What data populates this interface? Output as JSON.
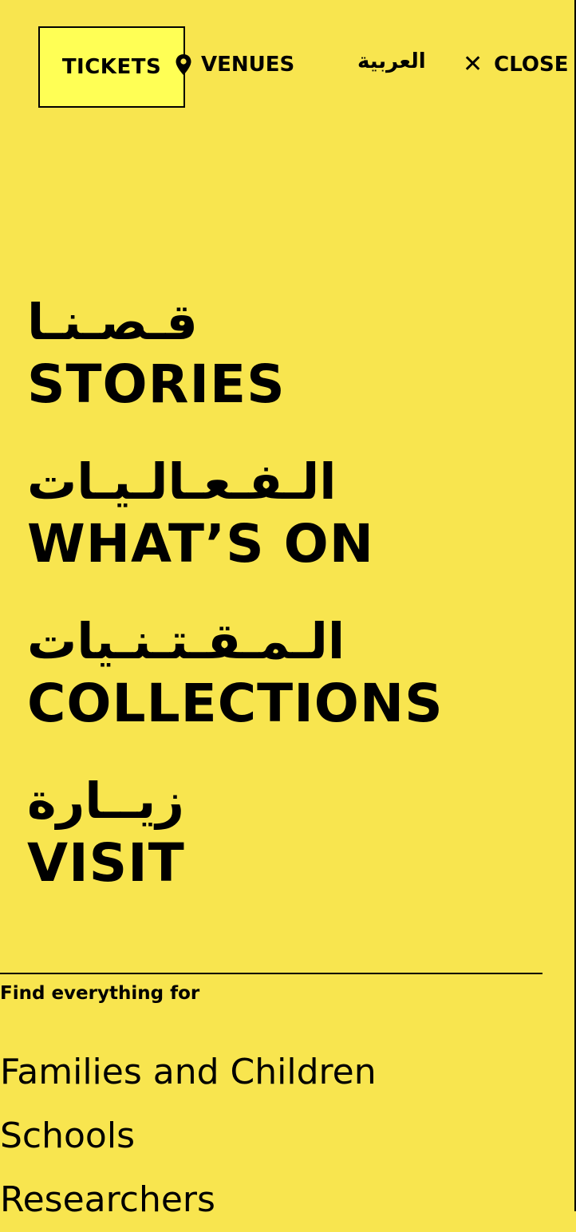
{
  "colors": {
    "background": "#f8e54f",
    "tickets_bg": "#ffff55",
    "text": "#000000"
  },
  "header": {
    "tickets_label": "TICKETS",
    "venues_label": "VENUES",
    "venues_icon": "map-pin-icon",
    "arabic_label": "العربية",
    "close_label": "CLOSE",
    "close_icon": "close-icon"
  },
  "nav": {
    "items": [
      {
        "arabic": "قـصـنـا",
        "english": "STORIES"
      },
      {
        "arabic": "الـفـعـالـيـات",
        "english": "WHAT’S ON"
      },
      {
        "arabic": "الـمـقـتـنـيات",
        "english": "COLLECTIONS"
      },
      {
        "arabic": "زيــارة",
        "english": "VISIT"
      }
    ]
  },
  "audience": {
    "heading": "Find everything for",
    "items": [
      "Families and Children",
      "Schools",
      "Researchers"
    ]
  }
}
